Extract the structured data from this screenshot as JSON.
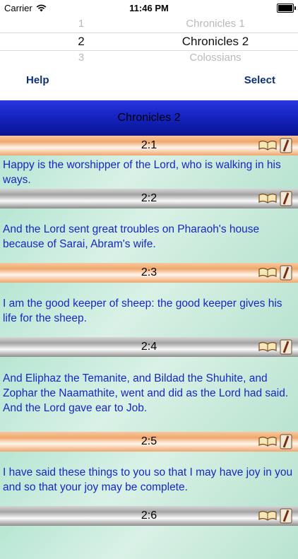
{
  "status_bar": {
    "carrier": "Carrier",
    "time": "11:46 PM"
  },
  "picker": {
    "rows": [
      {
        "num": "1",
        "book": "Chronicles 1"
      },
      {
        "num": "2",
        "book": "Chronicles 2"
      },
      {
        "num": "3",
        "book": "Colossians"
      }
    ]
  },
  "toolbar": {
    "help_label": "Help",
    "select_label": "Select"
  },
  "title": "Chronicles 2",
  "verses": [
    {
      "ref": "2:1",
      "text": "Happy is the worshipper of the Lord, who is walking in his ways."
    },
    {
      "ref": "2:2",
      "text": "And the Lord sent great troubles on Pharaoh's house because of Sarai, Abram's wife."
    },
    {
      "ref": "2:3",
      "text": "I am the good keeper of sheep: the good keeper gives his life for the sheep."
    },
    {
      "ref": "2:4",
      "text": "And Eliphaz the Temanite, and Bildad the Shuhite, and Zophar the Naamathite, went and did as the Lord had said. And the Lord gave ear to Job."
    },
    {
      "ref": "2:5",
      "text": "I have said these things to you so that I may have joy in you and so that your joy may be complete."
    },
    {
      "ref": "2:6",
      "text": ""
    }
  ],
  "icons": {
    "book": "open-book-icon",
    "pen": "pen-icon",
    "wifi": "wifi-icon",
    "battery": "battery-icon"
  },
  "colors": {
    "verse_text": "#1528c4",
    "title_bar": "#1524c2",
    "toolbar_text": "#0d2f7a"
  }
}
